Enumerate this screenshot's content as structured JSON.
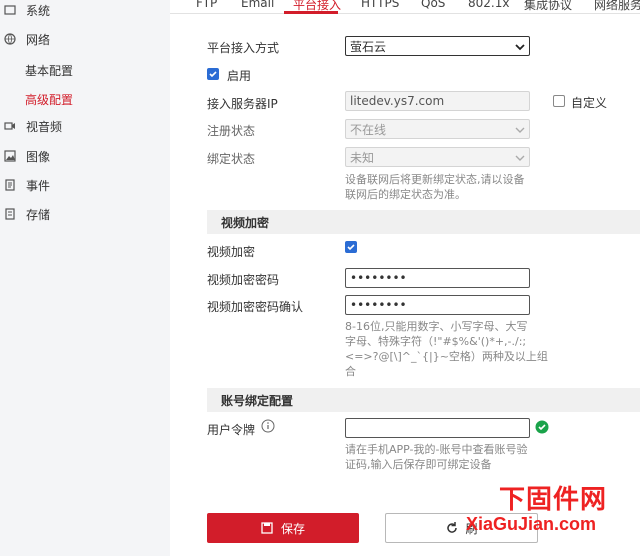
{
  "sidebar": {
    "items": [
      {
        "label": "系统",
        "icon": "system-icon"
      },
      {
        "label": "网络",
        "icon": "network-icon"
      },
      {
        "label": "视音频",
        "icon": "video-audio-icon"
      },
      {
        "label": "图像",
        "icon": "image-icon"
      },
      {
        "label": "事件",
        "icon": "event-icon"
      },
      {
        "label": "存储",
        "icon": "storage-icon"
      }
    ],
    "subitems": [
      {
        "label": "基本配置",
        "active": false
      },
      {
        "label": "高级配置",
        "active": true
      }
    ]
  },
  "tabs": [
    "FTP",
    "Email",
    "平台接入",
    "HTTPS",
    "QoS",
    "802.1x",
    "集成协议",
    "网络服务"
  ],
  "active_tab": "平台接入",
  "form": {
    "access_mode_label": "平台接入方式",
    "access_mode_value": "萤石云",
    "enable_label": "启用",
    "server_ip_label": "接入服务器IP",
    "server_ip_value": "litedev.ys7.com",
    "custom_label": "自定义",
    "reg_status_label": "注册状态",
    "reg_status_value": "不在线",
    "bind_status_label": "绑定状态",
    "bind_status_value": "未知",
    "bind_hint_1": "设备联网后将更新绑定状态,请以设备",
    "bind_hint_2": "联网后的绑定状态为准。"
  },
  "video_encrypt": {
    "section_title": "视频加密",
    "encrypt_label": "视频加密",
    "key_label": "视频加密密码",
    "key_value": "••••••••",
    "confirm_label": "视频加密密码确认",
    "confirm_value": "••••••••",
    "hint_1": "8-16位,只能用数字、小写字母、大写",
    "hint_2": "字母、特殊字符（!\"#$%&'()*+,-./:;",
    "hint_3": "<=>?@[\\]^_`{|}~空格）两种及以上组",
    "hint_4": "合"
  },
  "account_bind": {
    "section_title": "账号绑定配置",
    "token_label": "用户令牌",
    "token_value": "",
    "hint_1": "请在手机APP-我的-账号中查看账号验",
    "hint_2": "证码,输入后保存即可绑定设备"
  },
  "buttons": {
    "save": "保存",
    "refresh": "刷"
  },
  "watermark": {
    "cn": "下固件网",
    "en": "XiaGuJian.com"
  },
  "colors": {
    "accent": "#d21d2a",
    "checkbox": "#2b6cd4",
    "valid": "#1aa34a"
  }
}
